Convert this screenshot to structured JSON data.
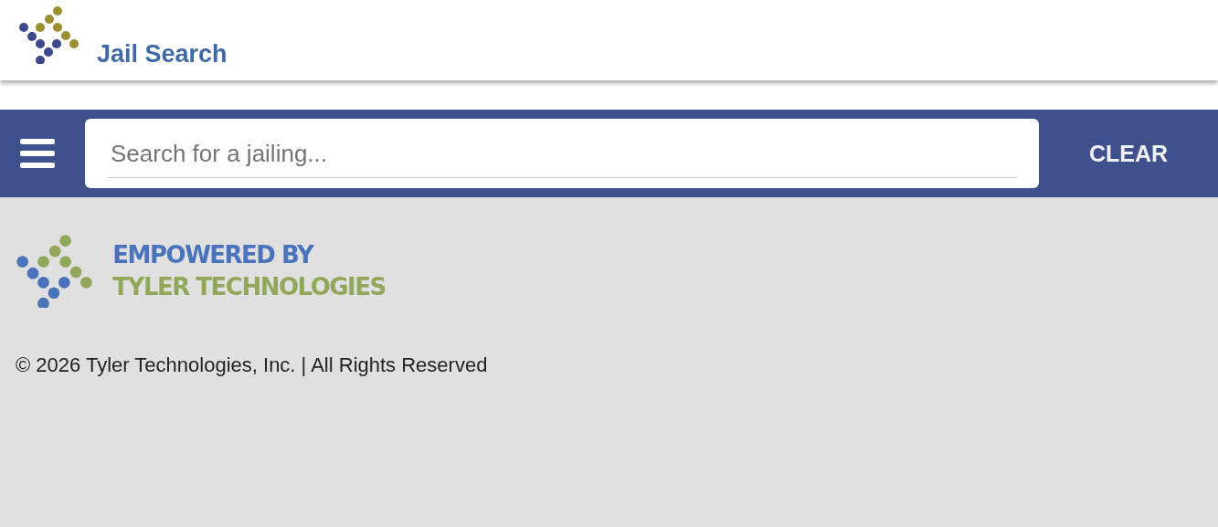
{
  "header": {
    "title": "Jail Search"
  },
  "search_bar": {
    "placeholder": "Search for a jailing...",
    "clear_button": "CLEAR"
  },
  "footer": {
    "logo_lines": [
      "EMPOWERED BY",
      "TYLER TECHNOLOGIES"
    ],
    "copyright": "© 2026 Tyler Technologies, Inc. | All Rights Reserved"
  }
}
